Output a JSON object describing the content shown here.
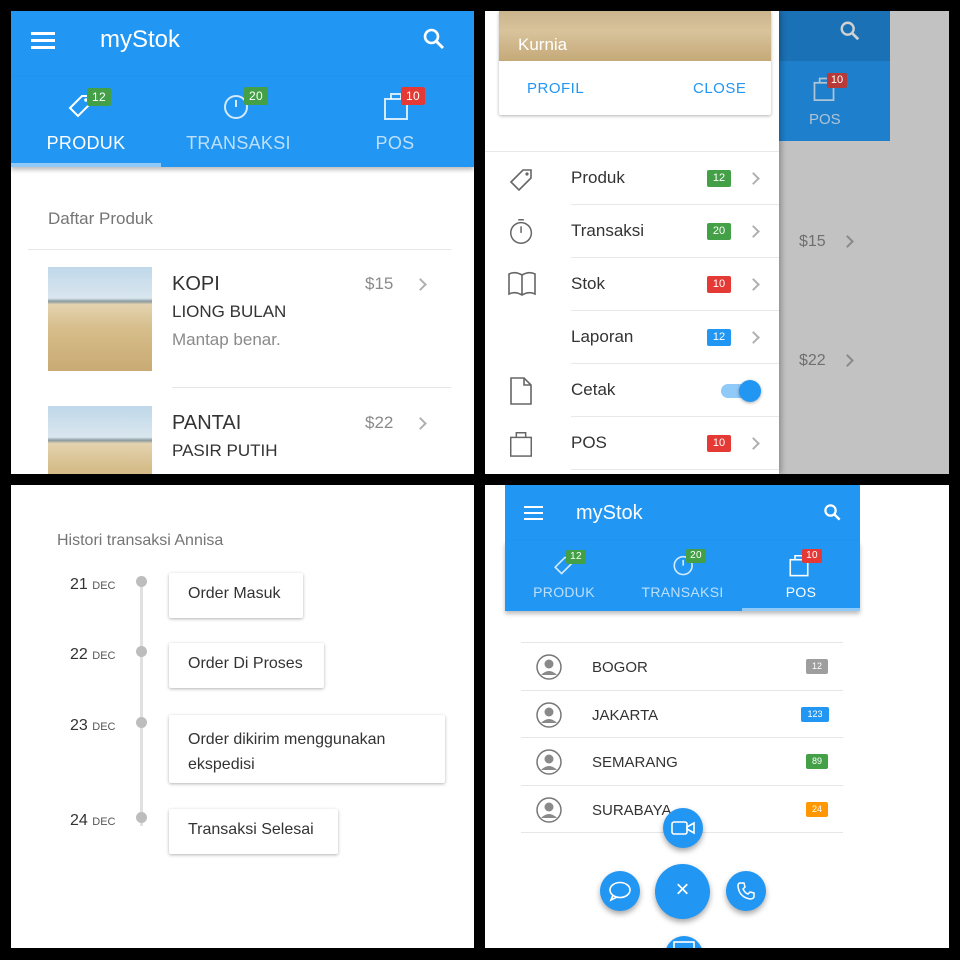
{
  "app_title": "myStok",
  "colors": {
    "primary": "#2196f3",
    "green": "#43a047",
    "red": "#e53935",
    "grey": "#9e9e9e",
    "orange": "#ff9800"
  },
  "tabs": [
    {
      "label": "PRODUK",
      "badge": "12",
      "icon": "tag-icon"
    },
    {
      "label": "TRANSAKSI",
      "badge": "20",
      "icon": "stopwatch-icon"
    },
    {
      "label": "POS",
      "badge": "10",
      "icon": "bag-icon"
    }
  ],
  "product_list": {
    "header": "Daftar Produk",
    "items": [
      {
        "title": "KOPI",
        "subtitle": "LIONG BULAN",
        "desc": "Mantap benar.",
        "price": "$15"
      },
      {
        "title": "PANTAI",
        "subtitle": "PASIR PUTIH",
        "desc": "",
        "price": "$22"
      }
    ]
  },
  "drawer": {
    "user_name": "Kurnia",
    "profile_button": "PROFIL",
    "close_button": "CLOSE",
    "items": [
      {
        "label": "Produk",
        "badge": "12",
        "icon": "tag-icon"
      },
      {
        "label": "Transaksi",
        "badge": "20",
        "icon": "stopwatch-icon"
      },
      {
        "label": "Stok",
        "badge": "10",
        "icon": "book-icon"
      },
      {
        "label": "Laporan",
        "badge": "12",
        "icon": ""
      },
      {
        "label": "Cetak",
        "toggle": true,
        "icon": "document-icon"
      },
      {
        "label": "POS",
        "badge": "10",
        "icon": "bag-icon"
      }
    ],
    "bg_prices": [
      "$15",
      "$22"
    ],
    "bg_pos_label": "POS",
    "bg_pos_badge": "10"
  },
  "history": {
    "title": "Histori transaksi Annisa",
    "events": [
      {
        "day": "21",
        "month": "DEC",
        "text": "Order Masuk"
      },
      {
        "day": "22",
        "month": "DEC",
        "text": "Order Di Proses"
      },
      {
        "day": "23",
        "month": "DEC",
        "text": "Order dikirim menggunakan ekspedisi"
      },
      {
        "day": "24",
        "month": "DEC",
        "text": "Transaksi Selesai"
      }
    ]
  },
  "pos_list": {
    "items": [
      {
        "city": "BOGOR",
        "count": "12",
        "color": "grey"
      },
      {
        "city": "JAKARTA",
        "count": "123",
        "color": "blue"
      },
      {
        "city": "SEMARANG",
        "count": "89",
        "color": "green"
      },
      {
        "city": "SURABAYA",
        "count": "24",
        "color": "orange"
      }
    ],
    "fab_actions": [
      "video-icon",
      "chat-icon",
      "phone-icon",
      "mail-icon"
    ],
    "fab_main": "×"
  }
}
